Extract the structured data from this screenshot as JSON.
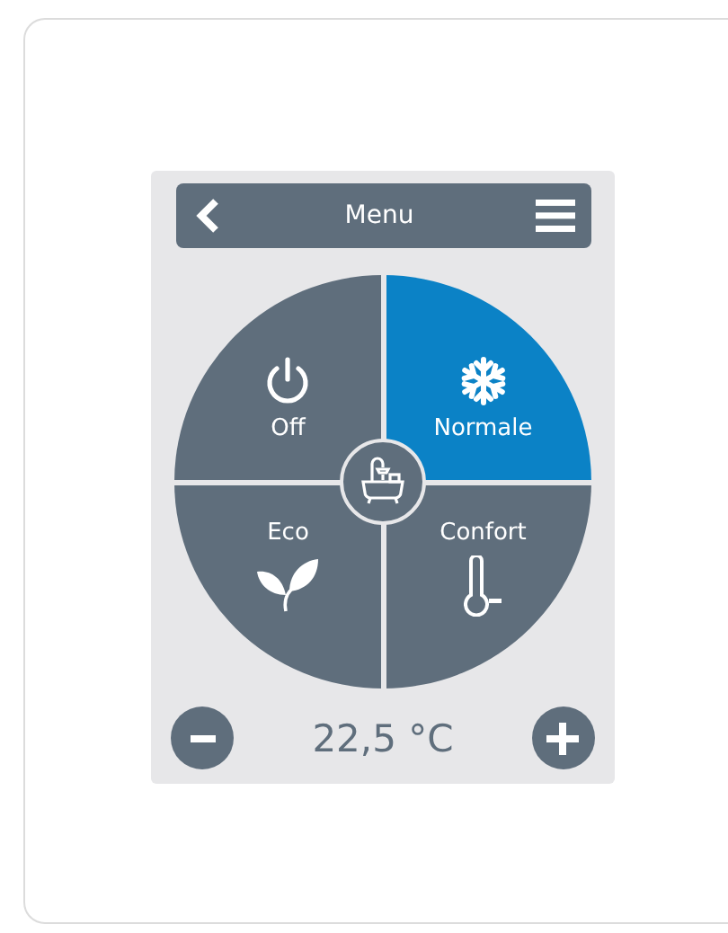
{
  "header": {
    "title": "Menu"
  },
  "modes": [
    {
      "label": "Off",
      "kind": "power",
      "selected": false
    },
    {
      "label": "Normale",
      "kind": "snowflake",
      "selected": true
    },
    {
      "label": "Eco",
      "kind": "leaf",
      "selected": false
    },
    {
      "label": "Confort",
      "kind": "thermometer",
      "selected": false
    }
  ],
  "temperature": "22,5 °C"
}
